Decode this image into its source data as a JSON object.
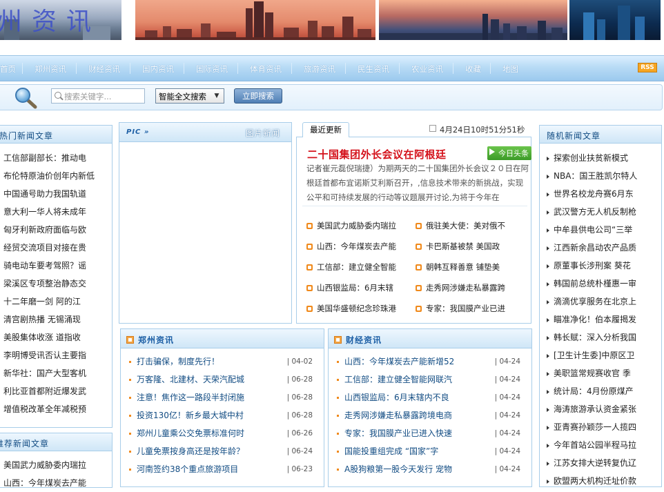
{
  "banner": {
    "logo_text": "州资讯"
  },
  "nav": {
    "items": [
      "首页",
      "郑州资讯",
      "财经资讯",
      "国内资讯",
      "国际资讯",
      "体育资讯",
      "旅游资讯",
      "民生资讯",
      "农业资讯",
      "收藏",
      "地图"
    ],
    "rss": "RSS"
  },
  "search": {
    "placeholder": "搜索关键字...",
    "select_value": "智能全文搜索",
    "button": "立即搜索"
  },
  "hot": {
    "title": "热门新闻文章",
    "items": [
      "工信部副部长：推动电",
      "布伦特原油价创年内新低",
      "中国通号助力我国轨道",
      "意大利一华人将未成年",
      "匈牙利新政府面临与欧",
      "经贸交流项目对接在贵",
      "骑电动车要考驾照？谣",
      "梁溪区专项整治静态交",
      "十二年磨一剑 阿的江",
      "清宫剧热播 无锡涌现",
      "美股集体收涨 道指收",
      "李明博受讯否认主要指",
      "新华社：国产大型客机",
      "利比亚首都附近爆发武",
      "增值税改革全年减税预"
    ]
  },
  "recommend": {
    "title": "推荐新闻文章",
    "items": [
      "美国武力威胁委内瑞拉",
      "山西：今年煤炭去产能"
    ]
  },
  "pic": {
    "label": "PIC »",
    "title": "图片新闻"
  },
  "latest": {
    "tab": "最近更新",
    "datetime": "4月24日10时51分51秒",
    "headline": "二十国集团外长会议在阿根廷",
    "badge": "今日头条",
    "summary": "记者崔元磊倪瑞捷）为期两天的二十国集团外长会议２０日在阿根廷首都布宜诺斯艾利斯召开，,信息技术带来的新挑战，实现公平和可持续发展的行动等议题展开讨论,为将于今年在",
    "grid": [
      [
        "美国武力威胁委内瑞拉",
        "俄驻美大使：美对俄不"
      ],
      [
        "山西：今年煤炭去产能",
        "卡巴斯基被禁 美国政"
      ],
      [
        "工信部：建立健全智能",
        "朝韩互释善意 铺垫美"
      ],
      [
        "山西银监局：6月末辖",
        "走秀网涉嫌走私暴露跨"
      ],
      [
        "美国华盛顿纪念珍珠港",
        "专家：我国膜产业已进"
      ]
    ]
  },
  "zhengzhou": {
    "title": "郑州资讯",
    "items": [
      {
        "t": "打击骗保，制度先行！",
        "d": "| 04-02"
      },
      {
        "t": "万客隆、北建材、天荣汽配城",
        "d": "| 06-28"
      },
      {
        "t": "注意！焦作这一路段半封闭施",
        "d": "| 06-28"
      },
      {
        "t": "投资130亿！新乡最大城中村",
        "d": "| 06-28"
      },
      {
        "t": "郑州儿童乘公交免票标准何时",
        "d": "| 06-26"
      },
      {
        "t": "儿童免票按身高还是按年龄？",
        "d": "| 06-24"
      },
      {
        "t": "河南签约38个重点旅游项目",
        "d": "| 06-23"
      }
    ]
  },
  "finance": {
    "title": "财经资讯",
    "items": [
      {
        "t": "山西：今年煤炭去产能新增52",
        "d": "| 04-24"
      },
      {
        "t": "工信部：建立健全智能网联汽",
        "d": "| 04-24"
      },
      {
        "t": "山西银监局：6月末辖内不良",
        "d": "| 04-24"
      },
      {
        "t": "走秀网涉嫌走私暴露跨境电商",
        "d": "| 04-24"
      },
      {
        "t": "专家：我国膜产业已进入快速",
        "d": "| 04-24"
      },
      {
        "t": "国能投重组完成 “国家”字",
        "d": "| 04-24"
      },
      {
        "t": "A股狗粮第一股今天发行 宠物",
        "d": "| 04-24"
      }
    ]
  },
  "random": {
    "title": "随机新闻文章",
    "items": [
      "探索创业扶贫新模式",
      "NBA：国王胜凯尔特人",
      "世界名校龙舟赛6月东",
      "武汉警方无人机反制枪",
      "中牟县供电公司“三举",
      "江西新余昌动农产品质",
      "原董事长涉刑案 葵花",
      "韩国前总统朴槿惠一审",
      "滴滴优享服务在北京上",
      "瞄准净化！伯本履揭发",
      "韩长赋：深入分析我国",
      "[卫生计生委]中原区卫",
      "美职篮常规赛收官 季",
      "统计局：4月份原煤产",
      "海涛旅游承认资金紧张",
      "亚青赛孙颖莎一人揽四",
      "今年首站公园半程马拉",
      "江苏女排大逆转复仇辽",
      "欧盟两大机构迁址价款"
    ]
  }
}
